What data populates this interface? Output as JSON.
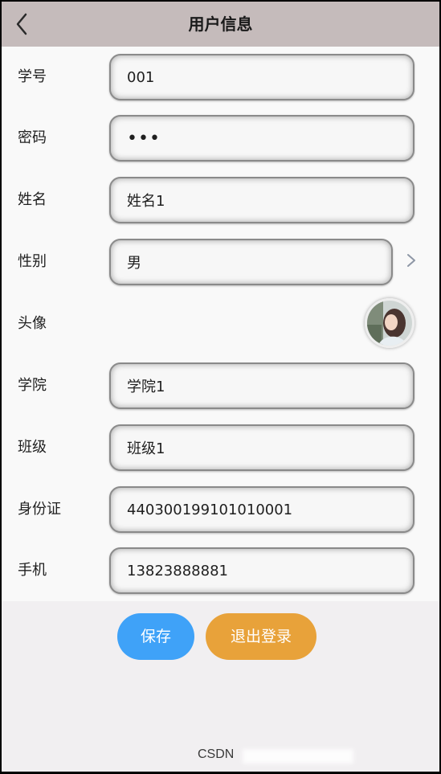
{
  "header": {
    "title": "用户信息",
    "back_icon": "chevron-left-icon"
  },
  "form": {
    "student_id": {
      "label": "学号",
      "value": "001"
    },
    "password": {
      "label": "密码",
      "value": "•••"
    },
    "name": {
      "label": "姓名",
      "value": "姓名1"
    },
    "gender": {
      "label": "性别",
      "value": "男",
      "icon": "chevron-right-icon"
    },
    "avatar": {
      "label": "头像"
    },
    "college": {
      "label": "学院",
      "value": "学院1"
    },
    "class": {
      "label": "班级",
      "value": "班级1"
    },
    "id_card": {
      "label": "身份证",
      "value": "440300199101010001"
    },
    "phone": {
      "label": "手机",
      "value": "13823888881"
    }
  },
  "actions": {
    "save_label": "保存",
    "logout_label": "退出登录"
  },
  "watermark": "CSDN",
  "colors": {
    "header_bg": "#c5bbbb",
    "save_button": "#3fa2f8",
    "logout_button": "#e8a23a",
    "page_bg": "#f1eff1"
  }
}
